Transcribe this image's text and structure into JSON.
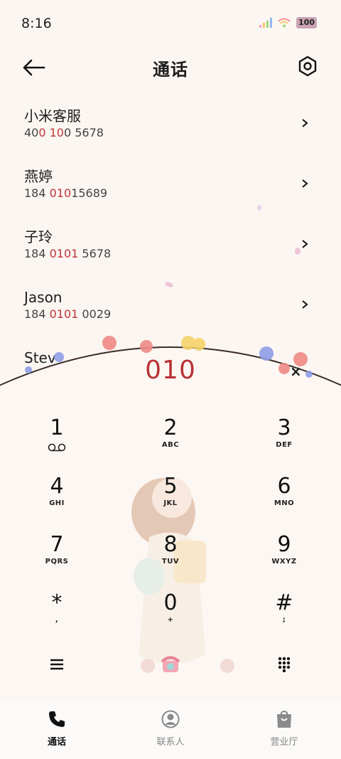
{
  "status_bar": {
    "time": "8:16",
    "battery": "100"
  },
  "header": {
    "title": "通话"
  },
  "results": [
    {
      "name": "小米客服",
      "number_parts": [
        "40",
        "0 10",
        "0 5678"
      ]
    },
    {
      "name": "燕婷",
      "number_parts": [
        "184 ",
        "010",
        "15689"
      ]
    },
    {
      "name": "子玲",
      "number_parts": [
        "184 ",
        "0101",
        " 5678"
      ]
    },
    {
      "name": "Jason",
      "number_parts": [
        "184 ",
        "0101",
        " 0029"
      ]
    },
    {
      "name": "Stev",
      "number_parts": [
        "",
        "",
        ""
      ]
    }
  ],
  "dialer": {
    "input": "010",
    "clear_label": "×",
    "keys": [
      {
        "digit": "1",
        "letters": ""
      },
      {
        "digit": "2",
        "letters": "ABC"
      },
      {
        "digit": "3",
        "letters": "DEF"
      },
      {
        "digit": "4",
        "letters": "GHI"
      },
      {
        "digit": "5",
        "letters": "JKL"
      },
      {
        "digit": "6",
        "letters": "MNO"
      },
      {
        "digit": "7",
        "letters": "PQRS"
      },
      {
        "digit": "8",
        "letters": "TUV"
      },
      {
        "digit": "9",
        "letters": "WXYZ"
      },
      {
        "digit": "*",
        "letters": ","
      },
      {
        "digit": "0",
        "letters": "+"
      },
      {
        "digit": "#",
        "letters": ";"
      }
    ]
  },
  "tabs": [
    {
      "label": "通话",
      "icon": "phone-icon",
      "active": true
    },
    {
      "label": "联系人",
      "icon": "contacts-icon",
      "active": false
    },
    {
      "label": "营业厅",
      "icon": "store-icon",
      "active": false
    }
  ],
  "colors": {
    "accent": "#c0353a",
    "background": "#fbf6f1"
  }
}
